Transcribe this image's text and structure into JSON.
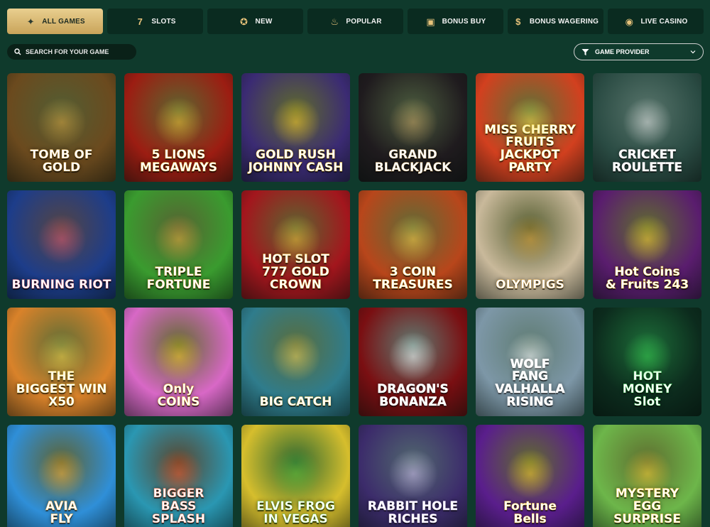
{
  "tabs": [
    {
      "label": "ALL GAMES",
      "icon": "slot-machine-icon",
      "glyph": "✦",
      "active": true
    },
    {
      "label": "SLOTS",
      "icon": "triple-seven-icon",
      "glyph": "7",
      "active": false
    },
    {
      "label": "NEW",
      "icon": "new-badge-icon",
      "glyph": "✪",
      "active": false
    },
    {
      "label": "POPULAR",
      "icon": "flame-icon",
      "glyph": "♨",
      "active": false
    },
    {
      "label": "BONUS BUY",
      "icon": "gift-icon",
      "glyph": "▣",
      "active": false
    },
    {
      "label": "BONUS WAGERING",
      "icon": "dollar-coin-icon",
      "glyph": "$",
      "active": false
    },
    {
      "label": "LIVE CASINO",
      "icon": "live-icon",
      "glyph": "◉",
      "active": false
    }
  ],
  "search": {
    "placeholder": "SEARCH FOR YOUR GAME"
  },
  "provider": {
    "label": "GAME PROVIDER"
  },
  "games": [
    {
      "title": "TOMB OF GOLD",
      "bg": "#6b4a1e",
      "accent": "#d9a441"
    },
    {
      "title": "5 LIONS\nMEGAWAYS",
      "bg": "#9c1d12",
      "accent": "#f3c037"
    },
    {
      "title": "GOLD RUSH\nJOHNNY CASH",
      "bg": "#3b2b73",
      "accent": "#ffcc2e"
    },
    {
      "title": "GRAND\nBLACKJACK",
      "bg": "#1f1b1e",
      "accent": "#c7a365"
    },
    {
      "title": "MISS CHERRY FRUITS\nJACKPOT PARTY",
      "bg": "#d2401f",
      "accent": "#fbe04d"
    },
    {
      "title": "CRICKET\nROULETTE",
      "bg": "#2a4b43",
      "accent": "#e7e7e7"
    },
    {
      "title": "BURNING RIOT",
      "bg": "#1d3d8a",
      "accent": "#e05a73"
    },
    {
      "title": "TRIPLE\nFORTUNE",
      "bg": "#3a9b2f",
      "accent": "#e9b13e"
    },
    {
      "title": "HOT SLOT\n777 GOLD CROWN",
      "bg": "#a3161d",
      "accent": "#f3bc3a"
    },
    {
      "title": "3 COIN\nTREASURES",
      "bg": "#b8461b",
      "accent": "#ffcf4a"
    },
    {
      "title": "OLYMPIGS",
      "bg": "#c9b99b",
      "accent": "#e1a43a"
    },
    {
      "title": "Hot Coins\n& Fruits 243",
      "bg": "#5a1d6e",
      "accent": "#ffd335"
    },
    {
      "title": "THE\nBIGGEST WIN\nX50",
      "bg": "#d9822a",
      "accent": "#f7d44b"
    },
    {
      "title": "Only\nCOINS",
      "bg": "#d868c6",
      "accent": "#ffcc2f"
    },
    {
      "title": "BIG CATCH",
      "bg": "#2f7c8c",
      "accent": "#f0d35d"
    },
    {
      "title": "DRAGON'S\nBONANZA",
      "bg": "#7a0f12",
      "accent": "#ffffff"
    },
    {
      "title": "WOLF\nFANG\nVALHALLA RISING",
      "bg": "#7d97a7",
      "accent": "#ffffff"
    },
    {
      "title": "HOT\nMONEY\nSlot",
      "bg": "#0c2b1d",
      "accent": "#39d151"
    },
    {
      "title": "AVIA\nFLY",
      "bg": "#2f8fd8",
      "accent": "#ffb43a"
    },
    {
      "title": "BIGGER\nBASS\nSPLASH",
      "bg": "#2a97b2",
      "accent": "#f25b2e"
    },
    {
      "title": "ELVIS FROG\nIN VEGAS",
      "bg": "#d6be2d",
      "accent": "#65c33a"
    },
    {
      "title": "RABBIT HOLE\nRICHES",
      "bg": "#3c2c6b",
      "accent": "#d4c3f2"
    },
    {
      "title": "Fortune\nBells",
      "bg": "#5a1e8c",
      "accent": "#ffcf2f"
    },
    {
      "title": "MYSTERY\nEGG\nSURPRISE",
      "bg": "#6db64a",
      "accent": "#ffd336"
    }
  ]
}
